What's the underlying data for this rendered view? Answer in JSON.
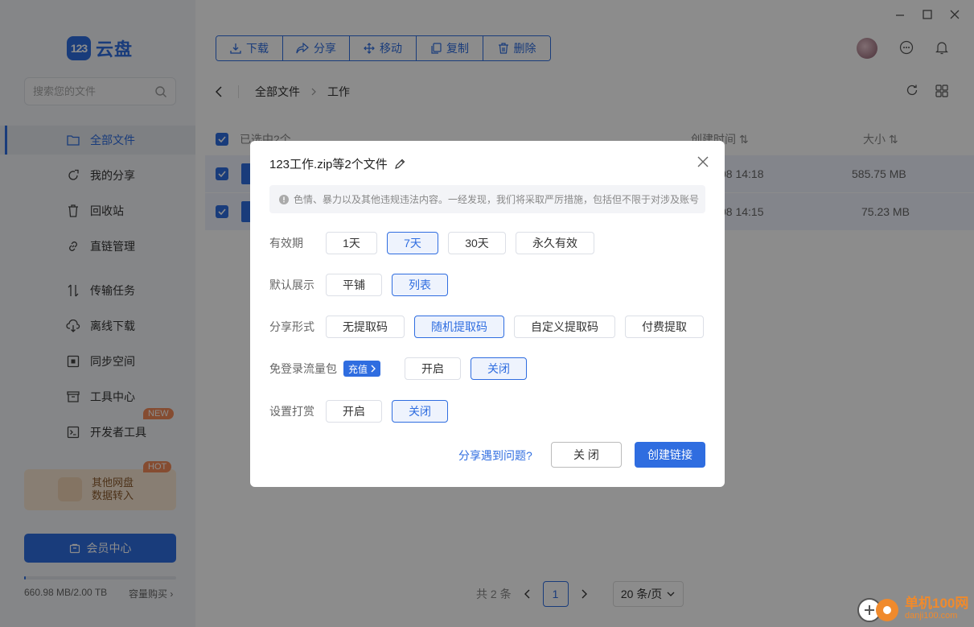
{
  "brand": {
    "logo_mark": "123",
    "logo_text": "云盘",
    "accent": "#2f6de0"
  },
  "search": {
    "placeholder": "搜索您的文件"
  },
  "sidebar": {
    "items": [
      {
        "label": "全部文件",
        "icon": "folder-icon",
        "active": true
      },
      {
        "label": "我的分享",
        "icon": "share-icon"
      },
      {
        "label": "回收站",
        "icon": "trash-icon"
      },
      {
        "label": "直链管理",
        "icon": "link-icon"
      },
      {
        "label": "传输任务",
        "icon": "transfer-icon"
      },
      {
        "label": "离线下载",
        "icon": "cloud-download-icon"
      },
      {
        "label": "同步空间",
        "icon": "sync-icon"
      },
      {
        "label": "工具中心",
        "icon": "toolbox-icon"
      },
      {
        "label": "开发者工具",
        "icon": "terminal-icon",
        "badge": "NEW"
      }
    ],
    "promo": {
      "line1": "其他网盘",
      "line2": "数据转入",
      "badge": "HOT"
    },
    "vip_label": "会员中心",
    "storage": {
      "used_text": "660.98 MB/2.00 TB",
      "used_fraction": 0.0003,
      "buy_label": "容量购买"
    }
  },
  "toolbar": {
    "buttons": [
      {
        "label": "下载",
        "icon": "download-icon"
      },
      {
        "label": "分享",
        "icon": "share-icon"
      },
      {
        "label": "移动",
        "icon": "move-icon"
      },
      {
        "label": "复制",
        "icon": "copy-icon"
      },
      {
        "label": "删除",
        "icon": "delete-icon"
      }
    ]
  },
  "breadcrumb": {
    "root": "全部文件",
    "current": "工作"
  },
  "list": {
    "selected_text": "已选中2个",
    "col_time": "创建时间",
    "col_size": "大小",
    "rows": [
      {
        "time": "08 14:18",
        "size": "585.75 MB"
      },
      {
        "time": "08 14:15",
        "size": "75.23 MB"
      }
    ]
  },
  "pager": {
    "total": "共 2 条",
    "current": "1",
    "page_size": "20 条/页"
  },
  "modal": {
    "title": "123工作.zip等2个文件",
    "notice": "色情、暴力以及其他违规违法内容。一经发现，我们将采取严厉措施，包括但不限于对涉及账号",
    "validity": {
      "label": "有效期",
      "options": [
        "1天",
        "7天",
        "30天",
        "永久有效"
      ],
      "selected": "7天"
    },
    "display": {
      "label": "默认展示",
      "options": [
        "平铺",
        "列表"
      ],
      "selected": "列表"
    },
    "share_type": {
      "label": "分享形式",
      "options": [
        "无提取码",
        "随机提取码",
        "自定义提取码",
        "付费提取"
      ],
      "selected": "随机提取码"
    },
    "traffic": {
      "label": "免登录流量包",
      "recharge": "充值",
      "options": [
        "开启",
        "关闭"
      ],
      "selected": "关闭"
    },
    "reward": {
      "label": "设置打赏",
      "options": [
        "开启",
        "关闭"
      ],
      "selected": "关闭"
    },
    "help_link": "分享遇到问题?",
    "close_label": "关 闭",
    "create_label": "创建链接"
  },
  "watermark": {
    "line1": "单机100网",
    "line2": "danji100.com"
  }
}
